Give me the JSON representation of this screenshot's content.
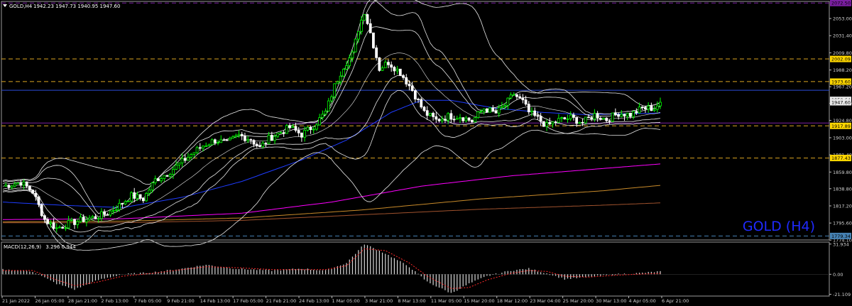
{
  "header": {
    "symbol": "GOLD,H4",
    "ohlc": "1942.23 1947.73 1940.95 1947.60"
  },
  "watermark": "GOLD (H4)",
  "colors": {
    "background": "#000000",
    "bull": "#00ff00",
    "bear": "#ffffff",
    "bands": "#e8e8e8",
    "ma_blue": "#1e3cff",
    "ma_magenta": "#ff00ff",
    "ma_orange": "#c88a2a",
    "ma_brown": "#a0522d",
    "level_gold": "#daa520",
    "level_gold_label": "#ffd700",
    "level_purple": "#7b1fa2",
    "level_blue": "#2a4bd7",
    "level_steel": "#4682b4",
    "macd_hist": "#d8d8d8",
    "macd_signal": "#ff2a2a",
    "watermark": "#1f2aff"
  },
  "chart_data": [
    {
      "type": "candlestick",
      "symbol": "GOLD",
      "timeframe": "H4",
      "ylim": [
        1774.3,
        2074.5
      ],
      "y_ticks": [
        "2053.00",
        "2031.40",
        "2009.80",
        "1988.20",
        "1967.20",
        "1946.40",
        "1924.80",
        "1903.00",
        "1881.40",
        "1859.80",
        "1838.80",
        "1817.20",
        "1795.60",
        "1774.10"
      ],
      "x_ticks": [
        "21 Jan 2022",
        "26 Jan 05:00",
        "28 Jan 21:00",
        "2 Feb 13:00",
        "7 Feb 05:00",
        "9 Feb 21:00",
        "14 Feb 13:00",
        "17 Feb 05:00",
        "21 Feb 21:00",
        "24 Feb 13:00",
        "1 Mar 05:00",
        "3 Mar 21:00",
        "8 Mar 13:00",
        "11 Mar 05:00",
        "15 Mar 20:00",
        "18 Mar 12:00",
        "23 Mar 04:00",
        "25 Mar 20:00",
        "30 Mar 13:00",
        "4 Apr 05:00",
        "6 Apr 21:00"
      ],
      "price_labels": [
        {
          "value": 2072.5,
          "text": "2072.50",
          "color": "level_purple"
        },
        {
          "value": 2002.09,
          "text": "2002.09",
          "color": "level_gold"
        },
        {
          "value": 1973.6,
          "text": "1973.60",
          "color": "level_gold"
        },
        {
          "value": 1950.64,
          "text": "1950.64",
          "color": "bands"
        },
        {
          "value": 1947.6,
          "text": "1947.60",
          "color": "bands"
        },
        {
          "value": 1917.89,
          "text": "1917.89",
          "color": "level_gold"
        },
        {
          "value": 1877.43,
          "text": "1877.43",
          "color": "level_gold"
        },
        {
          "value": 1779.34,
          "text": "1779.34",
          "color": "level_steel"
        }
      ],
      "levels": [
        {
          "value": 2072.5,
          "color": "level_purple",
          "style": "dashed"
        },
        {
          "value": 2002.09,
          "color": "level_gold",
          "style": "dashed"
        },
        {
          "value": 1973.6,
          "color": "level_gold",
          "style": "dashed"
        },
        {
          "value": 1962.7,
          "color": "level_blue",
          "style": "solid"
        },
        {
          "value": 1921.5,
          "color": "level_purple",
          "style": "solid"
        },
        {
          "value": 1917.89,
          "color": "level_gold",
          "style": "dashed"
        },
        {
          "value": 1877.43,
          "color": "level_gold",
          "style": "dashed"
        },
        {
          "value": 1779.34,
          "color": "level_steel",
          "style": "dashed"
        }
      ],
      "price_path": [
        [
          0,
          1842
        ],
        [
          6,
          1847
        ],
        [
          10,
          1835
        ],
        [
          14,
          1800
        ],
        [
          18,
          1789
        ],
        [
          22,
          1795
        ],
        [
          27,
          1800
        ],
        [
          31,
          1803
        ],
        [
          35,
          1808
        ],
        [
          39,
          1818
        ],
        [
          43,
          1830
        ],
        [
          47,
          1826
        ],
        [
          51,
          1850
        ],
        [
          55,
          1858
        ],
        [
          59,
          1870
        ],
        [
          63,
          1882
        ],
        [
          67,
          1893
        ],
        [
          71,
          1900
        ],
        [
          75,
          1896
        ],
        [
          79,
          1906
        ],
        [
          83,
          1901
        ],
        [
          86,
          1890
        ],
        [
          89,
          1902
        ],
        [
          93,
          1910
        ],
        [
          96,
          1916
        ],
        [
          100,
          1907
        ],
        [
          104,
          1918
        ],
        [
          108,
          1935
        ],
        [
          111,
          1968
        ],
        [
          114,
          1993
        ],
        [
          117,
          2008
        ],
        [
          119,
          2040
        ],
        [
          121,
          2062
        ],
        [
          123,
          2035
        ],
        [
          126,
          1990
        ],
        [
          129,
          1998
        ],
        [
          133,
          1985
        ],
        [
          137,
          1963
        ],
        [
          141,
          1935
        ],
        [
          145,
          1925
        ],
        [
          149,
          1930
        ],
        [
          153,
          1930
        ],
        [
          157,
          1924
        ],
        [
          161,
          1940
        ],
        [
          165,
          1934
        ],
        [
          168,
          1944
        ],
        [
          171,
          1958
        ],
        [
          174,
          1948
        ],
        [
          176,
          1935
        ],
        [
          179,
          1927
        ],
        [
          182,
          1918
        ],
        [
          186,
          1925
        ],
        [
          190,
          1928
        ],
        [
          194,
          1922
        ],
        [
          198,
          1932
        ],
        [
          202,
          1926
        ],
        [
          206,
          1934
        ],
        [
          210,
          1932
        ],
        [
          214,
          1940
        ],
        [
          218,
          1940
        ],
        [
          220,
          1947.6
        ]
      ],
      "moving_averages": [
        {
          "color": "ma_blue",
          "path": [
            [
              0,
              1822
            ],
            [
              20,
              1818
            ],
            [
              40,
              1815
            ],
            [
              60,
              1828
            ],
            [
              80,
              1848
            ],
            [
              100,
              1875
            ],
            [
              115,
              1900
            ],
            [
              130,
              1935
            ],
            [
              140,
              1950
            ],
            [
              150,
              1950
            ],
            [
              165,
              1940
            ],
            [
              180,
              1935
            ],
            [
              195,
              1932
            ],
            [
              220,
              1934
            ]
          ]
        },
        {
          "color": "ma_magenta",
          "path": [
            [
              0,
              1800
            ],
            [
              40,
              1801
            ],
            [
              80,
              1808
            ],
            [
              110,
              1822
            ],
            [
              140,
              1842
            ],
            [
              170,
              1855
            ],
            [
              200,
              1864
            ],
            [
              220,
              1870
            ]
          ]
        },
        {
          "color": "ma_orange",
          "path": [
            [
              0,
              1797
            ],
            [
              40,
              1798
            ],
            [
              80,
              1802
            ],
            [
              120,
              1812
            ],
            [
              160,
              1826
            ],
            [
              200,
              1836
            ],
            [
              220,
              1843
            ]
          ]
        },
        {
          "color": "ma_brown",
          "path": [
            [
              0,
              1796
            ],
            [
              40,
              1796
            ],
            [
              80,
              1799
            ],
            [
              120,
              1806
            ],
            [
              160,
              1813
            ],
            [
              200,
              1818
            ],
            [
              220,
              1821
            ]
          ]
        }
      ]
    },
    {
      "type": "bar",
      "name": "MACD(12,26,9)",
      "values_text": "3.296 0.944",
      "ylim": [
        -23.0,
        34.0
      ],
      "y_ticks": [
        "31.934",
        "0.00",
        "-21.109"
      ],
      "histogram_path": [
        [
          0,
          5
        ],
        [
          10,
          3
        ],
        [
          18,
          -10
        ],
        [
          24,
          -16
        ],
        [
          32,
          -6
        ],
        [
          40,
          0
        ],
        [
          50,
          2
        ],
        [
          60,
          6
        ],
        [
          68,
          10
        ],
        [
          78,
          6
        ],
        [
          90,
          4
        ],
        [
          100,
          6
        ],
        [
          108,
          4
        ],
        [
          115,
          12
        ],
        [
          121,
          32
        ],
        [
          128,
          22
        ],
        [
          136,
          8
        ],
        [
          142,
          -8
        ],
        [
          150,
          -20
        ],
        [
          156,
          -10
        ],
        [
          162,
          -2
        ],
        [
          170,
          4
        ],
        [
          176,
          6
        ],
        [
          182,
          1
        ],
        [
          188,
          -5
        ],
        [
          196,
          -3
        ],
        [
          205,
          0
        ],
        [
          212,
          1
        ],
        [
          220,
          3
        ]
      ],
      "signal_path": [
        [
          0,
          4
        ],
        [
          10,
          4
        ],
        [
          18,
          -6
        ],
        [
          24,
          -12
        ],
        [
          32,
          -8
        ],
        [
          40,
          -2
        ],
        [
          50,
          1
        ],
        [
          60,
          5
        ],
        [
          68,
          8
        ],
        [
          78,
          7
        ],
        [
          90,
          5
        ],
        [
          100,
          5
        ],
        [
          108,
          5
        ],
        [
          115,
          9
        ],
        [
          121,
          27
        ],
        [
          128,
          25
        ],
        [
          136,
          12
        ],
        [
          142,
          -2
        ],
        [
          150,
          -15
        ],
        [
          156,
          -14
        ],
        [
          162,
          -6
        ],
        [
          170,
          1
        ],
        [
          176,
          4
        ],
        [
          182,
          3
        ],
        [
          188,
          -2
        ],
        [
          196,
          -3
        ],
        [
          205,
          -1
        ],
        [
          212,
          0
        ],
        [
          220,
          1
        ]
      ]
    }
  ]
}
